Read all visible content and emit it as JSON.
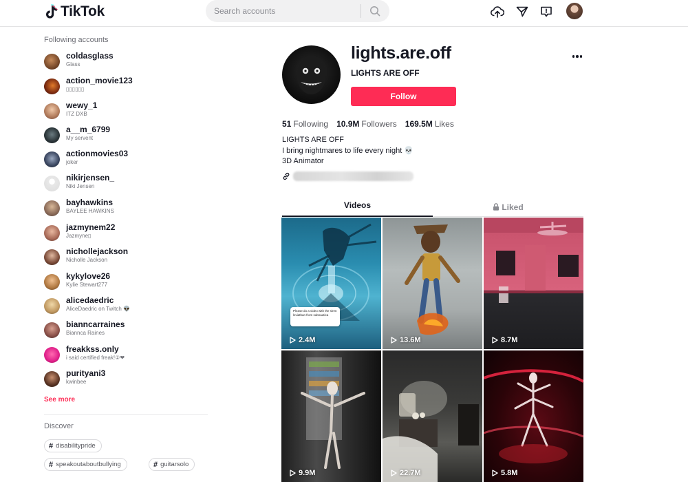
{
  "header": {
    "logo_text": "TikTok",
    "search_placeholder": "Search accounts"
  },
  "sidebar": {
    "following_title": "Following accounts",
    "accounts": [
      {
        "name": "coldasglass",
        "sub": "Glass"
      },
      {
        "name": "action_movie123",
        "sub": "▯▯▯▯▯▯"
      },
      {
        "name": "wewy_1",
        "sub": "ITZ DXB"
      },
      {
        "name": "a__m_6799",
        "sub": "My servent"
      },
      {
        "name": "actionmovies03",
        "sub": "joker"
      },
      {
        "name": "nikirjensen_",
        "sub": "Niki Jensen"
      },
      {
        "name": "bayhawkins",
        "sub": "BAYLEE HAWKINS"
      },
      {
        "name": "jazmynem22",
        "sub": "Jazmyne▯"
      },
      {
        "name": "nichollejackson",
        "sub": "Nicholle Jackson"
      },
      {
        "name": "kykylove26",
        "sub": "Kylie Stewart277"
      },
      {
        "name": "alicedaedric",
        "sub": "AliceDaedric on Twitch 👽"
      },
      {
        "name": "bianncarraines",
        "sub": "Biannca Raines"
      },
      {
        "name": "freakkss.only",
        "sub": "i said certified freak!②❤"
      },
      {
        "name": "purityani3",
        "sub": "kwinbee"
      }
    ],
    "see_more": "See more",
    "discover_title": "Discover",
    "tags": [
      "disabilitypride",
      "speakoutaboutbullying",
      "guitarsolo"
    ]
  },
  "profile": {
    "username": "lights.are.off",
    "nickname": "LIGHTS ARE OFF",
    "follow_label": "Follow",
    "stats": {
      "following": "51",
      "following_label": "Following",
      "followers": "10.9M",
      "followers_label": "Followers",
      "likes": "169.5M",
      "likes_label": "Likes"
    },
    "bio": [
      "LIGHTS ARE OFF",
      "I bring nightmares to life every night 💀",
      "3D Animator"
    ]
  },
  "tabs": {
    "videos": "Videos",
    "liked": "Liked"
  },
  "videos": [
    {
      "views": "2.4M",
      "caption": "Please do a video with the siren leviathan from subnautica"
    },
    {
      "views": "13.6M"
    },
    {
      "views": "8.7M"
    },
    {
      "views": "9.9M"
    },
    {
      "views": "22.7M"
    },
    {
      "views": "5.8M"
    }
  ],
  "colors": {
    "accent": "#fe2c55",
    "text": "#161823",
    "secondary": "#8a8b91"
  }
}
